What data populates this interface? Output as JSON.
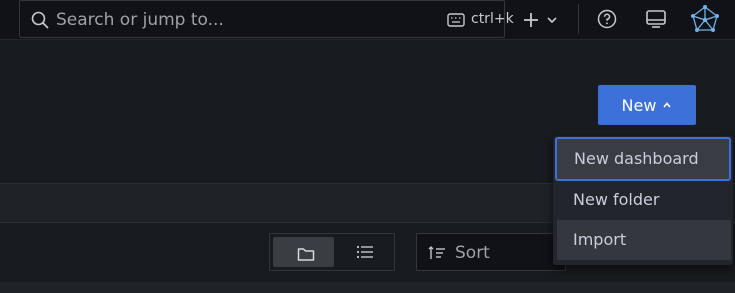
{
  "topbar": {
    "search_placeholder": "Search or jump to...",
    "search_shortcut": "ctrl+k"
  },
  "header": {
    "new_button_label": "New"
  },
  "new_menu": {
    "items": [
      {
        "label": "New dashboard",
        "state": "focused"
      },
      {
        "label": "New folder",
        "state": "default"
      },
      {
        "label": "Import",
        "state": "hover"
      }
    ]
  },
  "toolbar": {
    "sort_label": "Sort",
    "view_mode": "folders"
  },
  "colors": {
    "primary": "#3d71d9",
    "background": "#181b1f",
    "topbar": "#111217",
    "menu": "#22252b"
  },
  "icons": [
    "search-icon",
    "keyboard-icon",
    "plus-icon",
    "chevron-down-icon",
    "help-icon",
    "news-icon",
    "grafana-logo",
    "chevron-up-icon",
    "folder-icon",
    "list-icon",
    "sort-icon"
  ]
}
